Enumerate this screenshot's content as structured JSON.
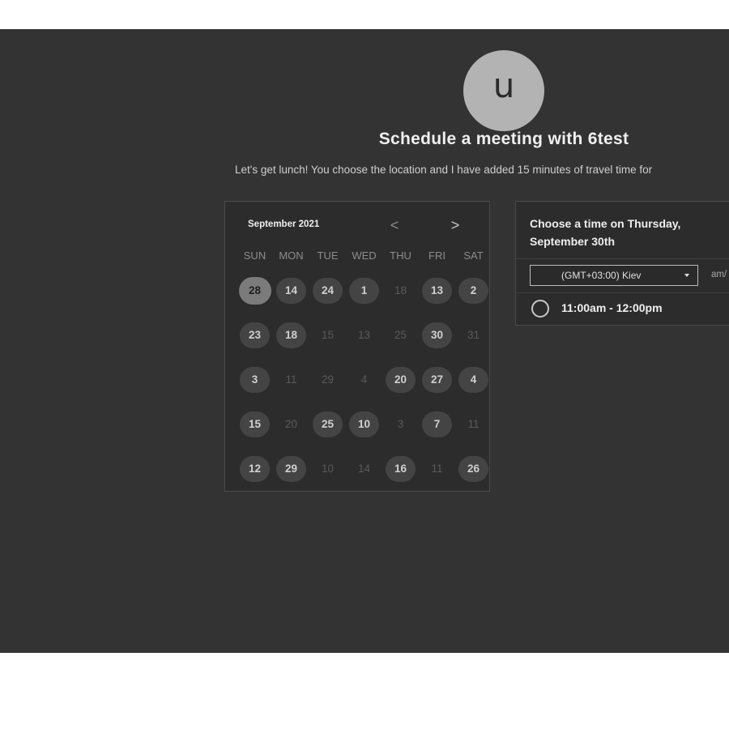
{
  "host": {
    "avatar_initial": "u"
  },
  "header": {
    "title": "Schedule a meeting with 6test",
    "description": "Let's get lunch! You choose the location and I have added 15 minutes of travel time for"
  },
  "calendar": {
    "month_label": "September 2021",
    "prev_icon": "chevron-left-icon",
    "next_icon": "chevron-right-icon",
    "prev_glyph": "<",
    "next_glyph": ">",
    "weekdays": [
      "SUN",
      "MON",
      "TUE",
      "WED",
      "THU",
      "FRI",
      "SAT"
    ],
    "weeks": [
      [
        {
          "d": "28",
          "s": "selected"
        },
        {
          "d": "14",
          "s": "available"
        },
        {
          "d": "24",
          "s": "available"
        },
        {
          "d": "1",
          "s": "available"
        },
        {
          "d": "18",
          "s": "disabled"
        },
        {
          "d": "13",
          "s": "available"
        },
        {
          "d": "2",
          "s": "available"
        }
      ],
      [
        {
          "d": "23",
          "s": "available"
        },
        {
          "d": "18",
          "s": "available"
        },
        {
          "d": "15",
          "s": "disabled"
        },
        {
          "d": "13",
          "s": "disabled"
        },
        {
          "d": "25",
          "s": "disabled"
        },
        {
          "d": "30",
          "s": "available"
        },
        {
          "d": "31",
          "s": "disabled"
        }
      ],
      [
        {
          "d": "3",
          "s": "available"
        },
        {
          "d": "11",
          "s": "disabled"
        },
        {
          "d": "29",
          "s": "disabled"
        },
        {
          "d": "4",
          "s": "disabled"
        },
        {
          "d": "20",
          "s": "available"
        },
        {
          "d": "27",
          "s": "available"
        },
        {
          "d": "4",
          "s": "available"
        }
      ],
      [
        {
          "d": "15",
          "s": "available"
        },
        {
          "d": "20",
          "s": "disabled"
        },
        {
          "d": "25",
          "s": "available"
        },
        {
          "d": "10",
          "s": "available"
        },
        {
          "d": "3",
          "s": "disabled"
        },
        {
          "d": "7",
          "s": "available"
        },
        {
          "d": "11",
          "s": "disabled"
        }
      ],
      [
        {
          "d": "12",
          "s": "available"
        },
        {
          "d": "29",
          "s": "available"
        },
        {
          "d": "10",
          "s": "disabled"
        },
        {
          "d": "14",
          "s": "disabled"
        },
        {
          "d": "16",
          "s": "available"
        },
        {
          "d": "11",
          "s": "disabled"
        },
        {
          "d": "26",
          "s": "available"
        }
      ]
    ]
  },
  "times": {
    "heading": "Choose a time on Thursday, September 30th",
    "timezone": "(GMT+03:00) Kiev",
    "format_toggle": "am/",
    "slots": [
      {
        "label": "11:00am - 12:00pm",
        "selected": false
      }
    ]
  },
  "colors": {
    "stage_bg": "#333333",
    "panel_bg": "#2c2c2c",
    "available_day_bg": "#444444",
    "selected_day_bg": "#7b7b7b",
    "avatar_bg": "#b3b3b3"
  }
}
